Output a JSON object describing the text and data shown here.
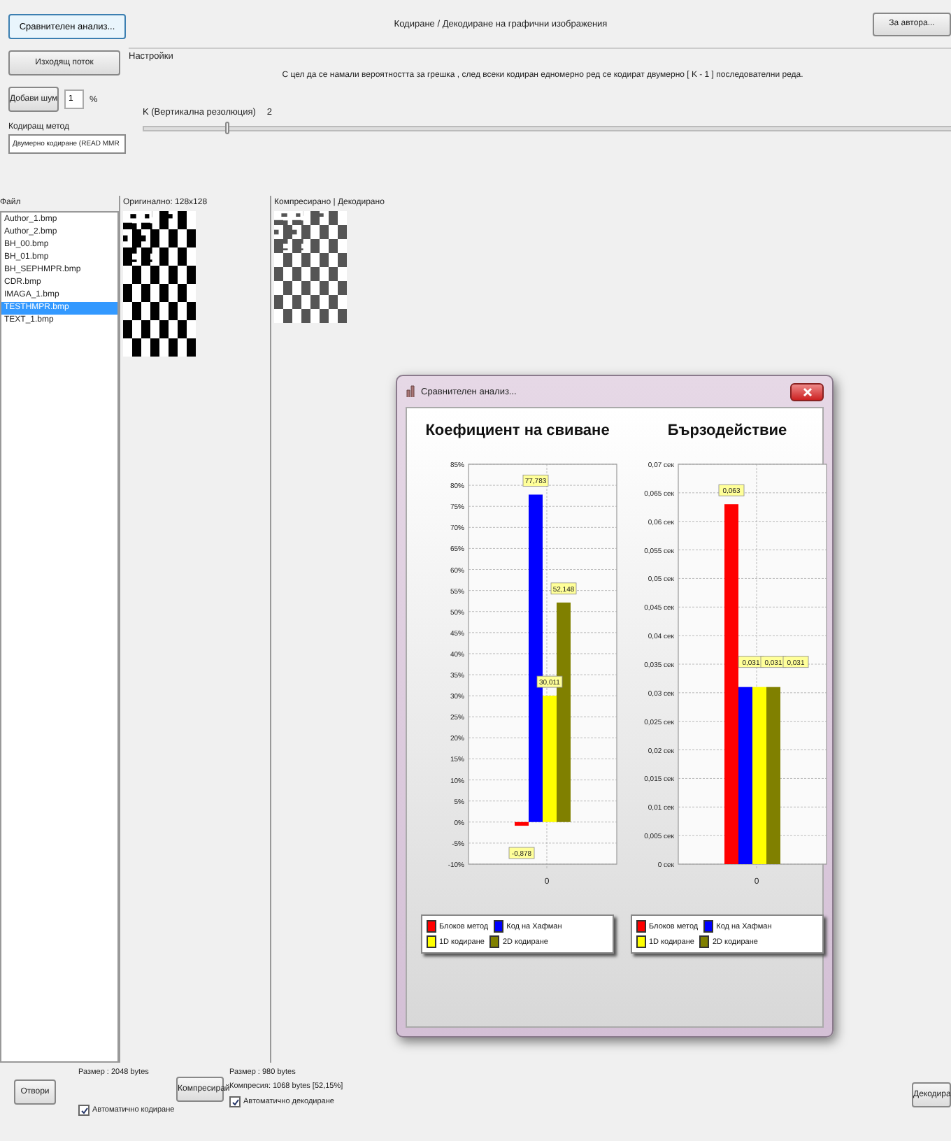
{
  "toolbar": {
    "compare_button": "Сравнителен анализ...",
    "title": "Кодиране / Декодиране на графични изображения",
    "about_button": "За автора...",
    "output_button": "Изходящ поток",
    "noise_button": "Добави шум",
    "noise_value": "1",
    "noise_unit": "%",
    "method_label": "Кодиращ метод",
    "method_value": "Двумерно кодиране (READ MMR"
  },
  "settings": {
    "title": "Настройки",
    "description": "С цел да се намали вероятността за грешка , след всеки кодиран едномерно ред се кодират двумерно [ K - 1 ] последователни реда.",
    "k_label": "K (Вертикална резолюция)",
    "k_value": "2",
    "level": 0.1
  },
  "files": {
    "header": "Файл",
    "items": [
      {
        "name": "Author_1.bmp",
        "selected": false
      },
      {
        "name": "Author_2.bmp",
        "selected": false
      },
      {
        "name": "BH_00.bmp",
        "selected": false
      },
      {
        "name": "BH_01.bmp",
        "selected": false
      },
      {
        "name": "BH_SEPHMPR.bmp",
        "selected": false
      },
      {
        "name": "CDR.bmp",
        "selected": false
      },
      {
        "name": "IMAGA_1.bmp",
        "selected": false
      },
      {
        "name": "TESTHMPR.bmp",
        "selected": true
      },
      {
        "name": "TEXT_1.bmp",
        "selected": false
      }
    ]
  },
  "original": {
    "header": "Оригинално: 128x128"
  },
  "compressed": {
    "header": "Компресирано | Декодирано"
  },
  "bottom": {
    "open_button": "Отвори",
    "original_size": "Размер : 2048 bytes",
    "auto_encode": {
      "label": "Автоматично кодиране",
      "checked": true
    },
    "compress_button": "Компресирай",
    "compressed_size": "Размер :   980 bytes",
    "compression": "Компресия: 1068 bytes [52,15%]",
    "auto_decode": {
      "label": "Автоматично декодиране",
      "checked": true
    },
    "decode_button": "Декодира"
  },
  "dialog": {
    "title": "Сравнителен анализ...",
    "charts": [
      {
        "chart_data": {
          "type": "bar",
          "title": "Коефициент на свиване",
          "categories": [
            "0"
          ],
          "series": [
            {
              "name": "Блоков метод",
              "color": "#ff0000",
              "values": [
                -0.878
              ]
            },
            {
              "name": "Код на Хафман",
              "color": "#0000ff",
              "values": [
                77.783
              ]
            },
            {
              "name": "1D кодиране",
              "color": "#ffff00",
              "values": [
                30.011
              ]
            },
            {
              "name": "2D кодиране",
              "color": "#808000",
              "values": [
                52.148
              ]
            }
          ],
          "ylim": [
            -10,
            85
          ],
          "yticks": [
            {
              "value": -10,
              "label": "-10%"
            },
            {
              "value": -5,
              "label": "-5%"
            },
            {
              "value": 0,
              "label": "0%"
            },
            {
              "value": 5,
              "label": "5%"
            },
            {
              "value": 10,
              "label": "10%"
            },
            {
              "value": 15,
              "label": "15%"
            },
            {
              "value": 20,
              "label": "20%"
            },
            {
              "value": 25,
              "label": "25%"
            },
            {
              "value": 30,
              "label": "30%"
            },
            {
              "value": 35,
              "label": "35%"
            },
            {
              "value": 40,
              "label": "40%"
            },
            {
              "value": 45,
              "label": "45%"
            },
            {
              "value": 50,
              "label": "50%"
            },
            {
              "value": 55,
              "label": "55%"
            },
            {
              "value": 60,
              "label": "60%"
            },
            {
              "value": 65,
              "label": "65%"
            },
            {
              "value": 70,
              "label": "70%"
            },
            {
              "value": 75,
              "label": "75%"
            },
            {
              "value": 80,
              "label": "80%"
            },
            {
              "value": 85,
              "label": "85%"
            }
          ],
          "value_labels": [
            "-0,878",
            "77,783",
            "30,011",
            "52,148"
          ],
          "grid": true
        }
      },
      {
        "chart_data": {
          "type": "bar",
          "title": "Бързодействие",
          "categories": [
            "0"
          ],
          "series": [
            {
              "name": "Блоков метод",
              "color": "#ff0000",
              "values": [
                0.063
              ]
            },
            {
              "name": "Код на Хафман",
              "color": "#0000ff",
              "values": [
                0.031
              ]
            },
            {
              "name": "1D кодиране",
              "color": "#ffff00",
              "values": [
                0.031
              ]
            },
            {
              "name": "2D кодиране",
              "color": "#808000",
              "values": [
                0.031
              ]
            }
          ],
          "ylim": [
            0,
            0.07
          ],
          "yticks": [
            {
              "value": 0,
              "label": "0 сек"
            },
            {
              "value": 0.005,
              "label": "0,005 сек"
            },
            {
              "value": 0.01,
              "label": "0,01 сек"
            },
            {
              "value": 0.015,
              "label": "0,015 сек"
            },
            {
              "value": 0.02,
              "label": "0,02 сек"
            },
            {
              "value": 0.025,
              "label": "0,025 сек"
            },
            {
              "value": 0.03,
              "label": "0,03 сек"
            },
            {
              "value": 0.035,
              "label": "0,035 сек"
            },
            {
              "value": 0.04,
              "label": "0,04 сек"
            },
            {
              "value": 0.045,
              "label": "0,045 сек"
            },
            {
              "value": 0.05,
              "label": "0,05 сек"
            },
            {
              "value": 0.055,
              "label": "0,055 сек"
            },
            {
              "value": 0.06,
              "label": "0,06 сек"
            },
            {
              "value": 0.065,
              "label": "0,065 сек"
            },
            {
              "value": 0.07,
              "label": "0,07 сек"
            }
          ],
          "value_labels": [
            "0,063",
            "0,031",
            "0,031",
            "0,031"
          ],
          "grid": true
        }
      }
    ]
  }
}
